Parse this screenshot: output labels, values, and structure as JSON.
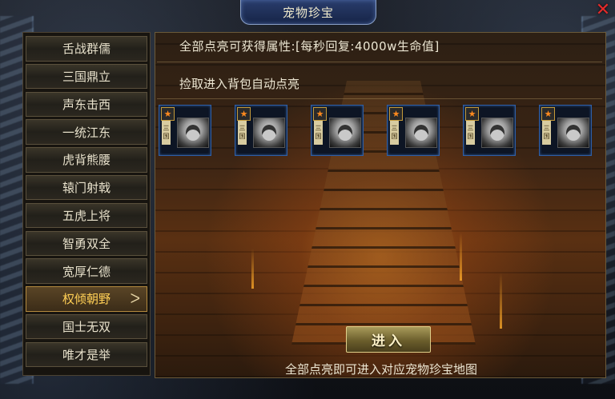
{
  "window": {
    "title": "宠物珍宝",
    "close_label": "✕"
  },
  "sidebar": {
    "items": [
      {
        "label": "舌战群儒"
      },
      {
        "label": "三国鼎立"
      },
      {
        "label": "声东击西"
      },
      {
        "label": "一统江东"
      },
      {
        "label": "虎背熊腰"
      },
      {
        "label": "辕门射戟"
      },
      {
        "label": "五虎上将"
      },
      {
        "label": "智勇双全"
      },
      {
        "label": "宽厚仁德"
      },
      {
        "label": "权倾朝野",
        "active": true,
        "arrow": "ᐳ"
      },
      {
        "label": "国士无双"
      },
      {
        "label": "唯才是举"
      }
    ]
  },
  "main": {
    "attribute_text": "全部点亮可获得属性:[每秒回复:4000w生命值]",
    "hint_text": "捡取进入背包自动点亮",
    "cards": [
      {
        "star": "★",
        "tag_top": "三",
        "tag_bottom": "国",
        "portrait": "general-portrait-1"
      },
      {
        "star": "★",
        "tag_top": "三",
        "tag_bottom": "国",
        "portrait": "general-portrait-2"
      },
      {
        "star": "★",
        "tag_top": "三",
        "tag_bottom": "国",
        "portrait": "general-portrait-3"
      },
      {
        "star": "★",
        "tag_top": "三",
        "tag_bottom": "国",
        "portrait": "general-portrait-4"
      },
      {
        "star": "★",
        "tag_top": "三",
        "tag_bottom": "国",
        "portrait": "general-portrait-5"
      },
      {
        "star": "★",
        "tag_top": "三",
        "tag_bottom": "国",
        "portrait": "general-portrait-6"
      }
    ],
    "enter_button": "进入",
    "footer_text": "全部点亮即可进入对应宠物珍宝地图"
  },
  "colors": {
    "accent_gold": "#ffcf55",
    "card_border": "#2d5fa8",
    "close_red": "#e42a2a"
  }
}
